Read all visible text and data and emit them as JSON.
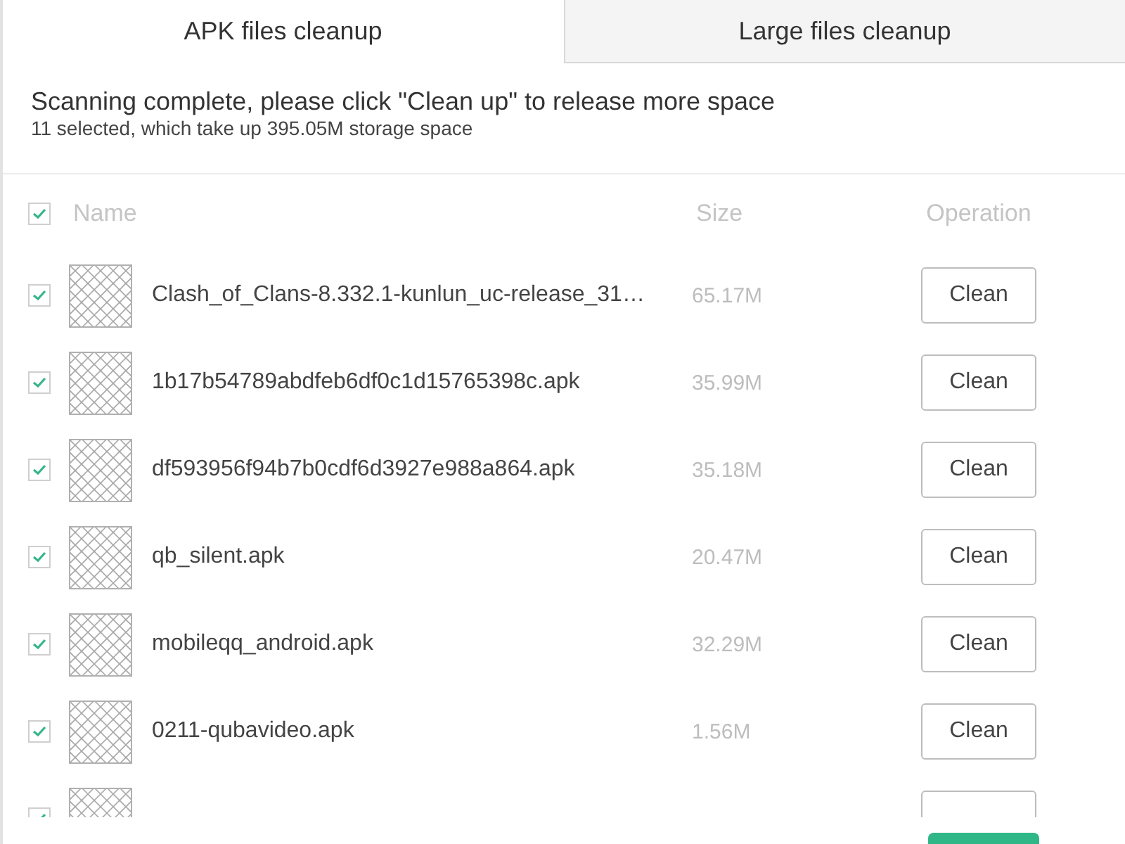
{
  "tabs": [
    {
      "label": "APK files cleanup",
      "selected": true
    },
    {
      "label": "Large files cleanup",
      "selected": false
    }
  ],
  "summary": {
    "title": "Scanning complete, please click \"Clean up\" to release more space",
    "detail": "11 selected, which take up 395.05M storage space"
  },
  "table": {
    "select_all": {
      "checked": true
    },
    "columns": [
      "Name",
      "Size",
      "Operation"
    ],
    "rows": [
      {
        "checked": true,
        "name": "Clash_of_Clans-8.332.1-kunlun_uc-release_31…",
        "size": "65.17M",
        "action": "Clean"
      },
      {
        "checked": true,
        "name": "1b17b54789abdfeb6df0c1d15765398c.apk",
        "size": "35.99M",
        "action": "Clean"
      },
      {
        "checked": true,
        "name": "df593956f94b7b0cdf6d3927e988a864.apk",
        "size": "35.18M",
        "action": "Clean"
      },
      {
        "checked": true,
        "name": "qb_silent.apk",
        "size": "20.47M",
        "action": "Clean"
      },
      {
        "checked": true,
        "name": "mobileqq_android.apk",
        "size": "32.29M",
        "action": "Clean"
      },
      {
        "checked": true,
        "name": "0211-qubavideo.apk",
        "size": "1.56M",
        "action": "Clean"
      },
      {
        "checked": true
      }
    ]
  }
}
